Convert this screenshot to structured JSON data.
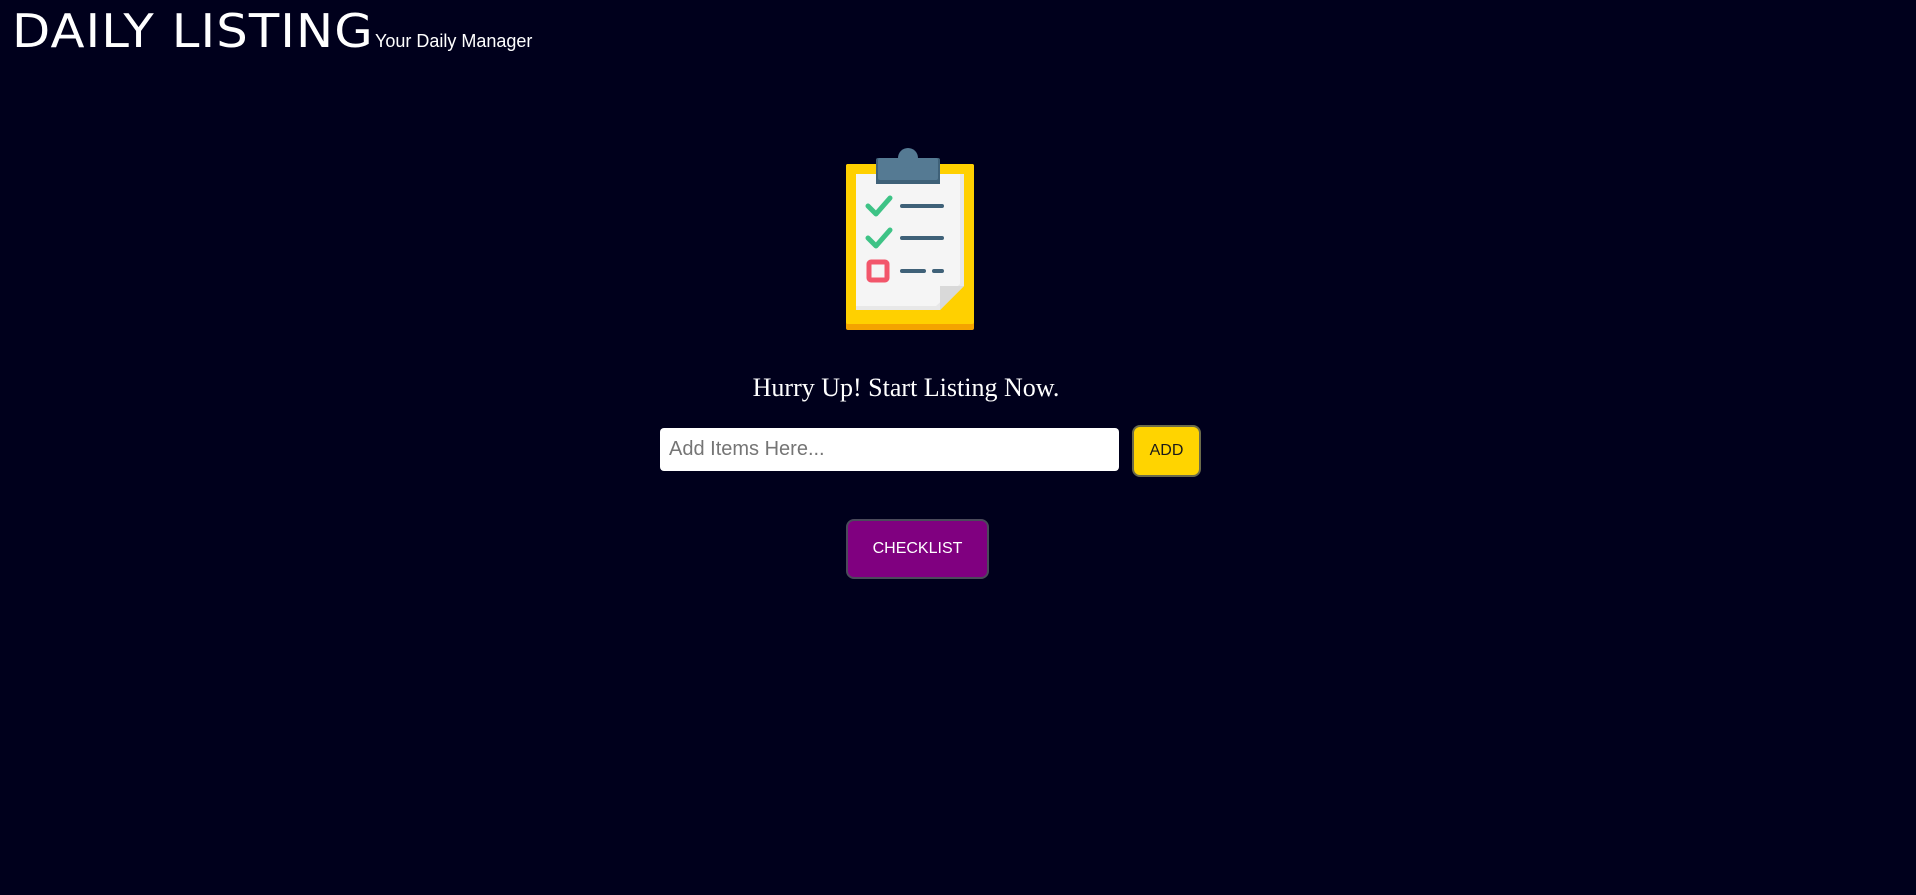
{
  "header": {
    "title": "DAILY LISTING",
    "tagline": "Your Daily Manager"
  },
  "hero": {
    "illustration_icon": "clipboard-checklist-icon",
    "headline": "Hurry Up! Start Listing Now."
  },
  "form": {
    "input_value": "",
    "input_placeholder": "Add Items Here...",
    "add_label": "ADD"
  },
  "actions": {
    "checklist_label": "CHECKLIST"
  },
  "colors": {
    "background": "#00001c",
    "add_button": "#ffd400",
    "checklist_button": "#800080",
    "text": "#ffffff"
  }
}
